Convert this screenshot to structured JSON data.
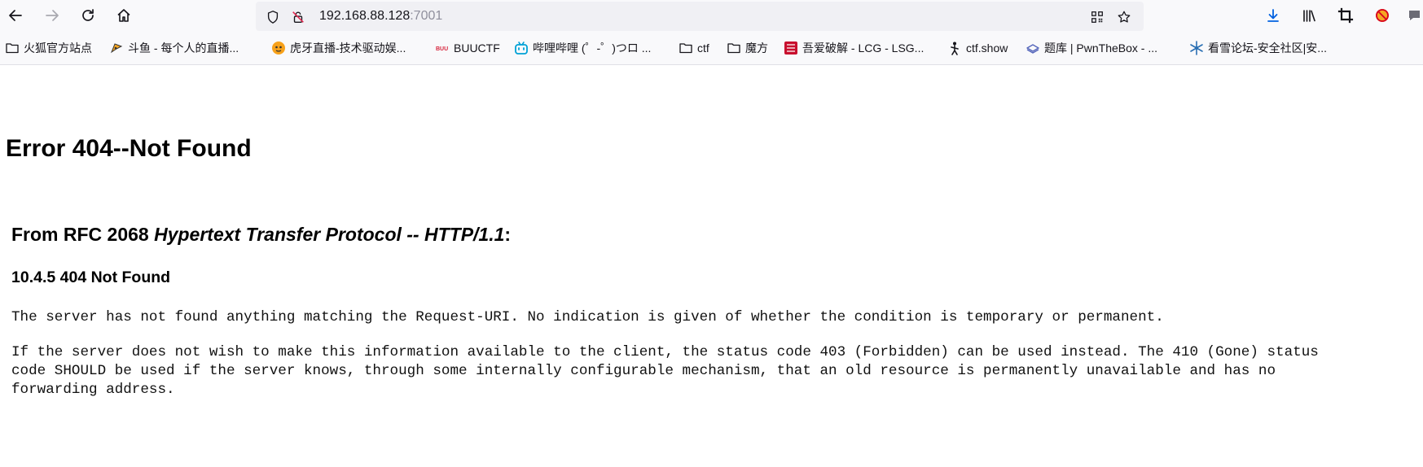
{
  "browser": {
    "url_host": "192.168.88.128",
    "url_port": ":7001"
  },
  "bookmarks": [
    {
      "label": "火狐官方站点",
      "icon": "folder-icon"
    },
    {
      "label": "斗鱼 - 每个人的直播...",
      "icon": "douyu-icon"
    },
    {
      "label": "虎牙直播-技术驱动娱...",
      "icon": "huya-icon"
    },
    {
      "label": "BUUCTF",
      "icon": "buuctf-icon"
    },
    {
      "label": "哔哩哔哩 (゜-゜)つロ ...",
      "icon": "bilibili-icon"
    },
    {
      "label": "ctf",
      "icon": "folder-icon"
    },
    {
      "label": "魔方",
      "icon": "folder-icon"
    },
    {
      "label": "吾爱破解 - LCG - LSG...",
      "icon": "52pojie-icon"
    },
    {
      "label": "ctf.show",
      "icon": "ctfshow-icon"
    },
    {
      "label": "题库 | PwnTheBox - ...",
      "icon": "pwnthebox-icon"
    },
    {
      "label": "看雪论坛-安全社区|安...",
      "icon": "kanxue-icon"
    }
  ],
  "page": {
    "title": "Error 404--Not Found",
    "rfc_prefix": "From RFC 2068 ",
    "rfc_italic": "Hypertext Transfer Protocol -- HTTP/1.1",
    "rfc_suffix": ":",
    "section": "10.4.5 404 Not Found",
    "para1": "The server has not found anything matching the Request-URI. No indication is given of whether the condition is temporary or permanent.",
    "para2": "If the server does not wish to make this information available to the client, the status code 403 (Forbidden) can be used instead. The 410 (Gone) status\ncode SHOULD be used if the server knows, through some internally configurable mechanism, that an old resource is permanently unavailable and has no\nforwarding address."
  },
  "colors": {
    "toolbar_bg": "#f9f9fb",
    "urlbar_bg": "#f0f0f4",
    "download_accent": "#0061e0"
  }
}
